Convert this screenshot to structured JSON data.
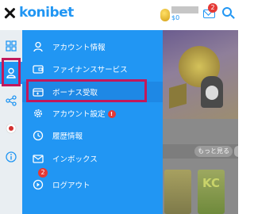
{
  "header": {
    "close_icon": "close-icon",
    "logo_text": "konibet",
    "balance": "$0",
    "mail_badge": "2",
    "mail_icon": "mail-icon",
    "search_icon": "search-icon"
  },
  "rail": {
    "items": [
      {
        "icon": "grid-icon"
      },
      {
        "icon": "user-icon",
        "active": true
      },
      {
        "icon": "share-icon"
      },
      {
        "icon": "flag-icon"
      },
      {
        "icon": "info-icon"
      }
    ]
  },
  "menu": {
    "items": [
      {
        "label": "アカウント情報",
        "icon": "user-icon"
      },
      {
        "label": "ファイナンスサービス",
        "icon": "wallet-icon"
      },
      {
        "label": "ボーナス受取",
        "icon": "bonus-icon",
        "highlighted": true
      },
      {
        "label": "アカウント設定",
        "icon": "settings-icon",
        "alert": "!"
      },
      {
        "label": "履歴情報",
        "icon": "history-icon"
      },
      {
        "label": "インボックス",
        "icon": "inbox-icon",
        "badge": "2"
      },
      {
        "label": "ログアウト",
        "icon": "logout-icon"
      }
    ]
  },
  "background": {
    "more_label": "もっと見る",
    "thumb_text": "KC"
  },
  "colors": {
    "panel": "#2196f3",
    "highlight_border": "#c2185b",
    "badge": "#e53935"
  }
}
